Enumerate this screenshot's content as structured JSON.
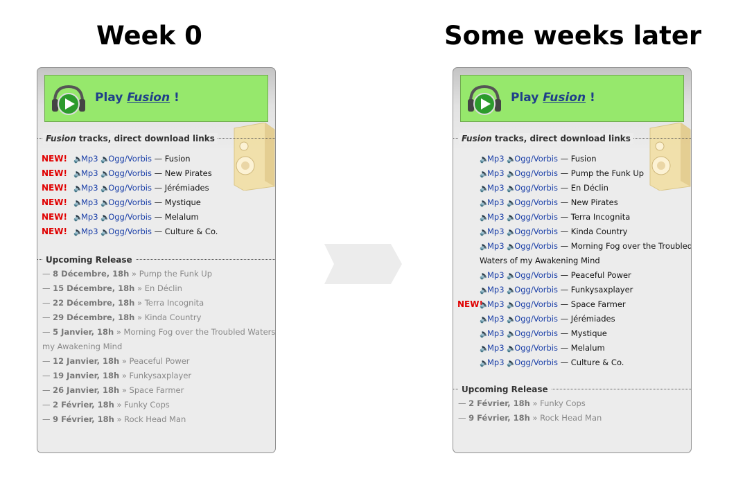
{
  "headings": {
    "left": "Week 0",
    "right": "Some weeks later"
  },
  "play": {
    "prefix": "Play",
    "album": "Fusion",
    "suffix": "!"
  },
  "section_tracks": {
    "album": "Fusion",
    "rest": " tracks, direct download links"
  },
  "section_upcoming": {
    "label": "Upcoming Release"
  },
  "link_labels": {
    "mp3": "Mp3",
    "ogg": "Ogg/Vorbis",
    "dash": "—",
    "new": "NEW!"
  },
  "week0": {
    "tracks": [
      {
        "title": "Fusion",
        "new": true
      },
      {
        "title": "New Pirates",
        "new": true
      },
      {
        "title": "Jérémiades",
        "new": true
      },
      {
        "title": "Mystique",
        "new": true
      },
      {
        "title": "Melalum",
        "new": true
      },
      {
        "title": "Culture & Co.",
        "new": true
      }
    ],
    "upcoming": [
      {
        "date": "8 Décembre, 18h",
        "title": "Pump the Funk Up"
      },
      {
        "date": "15 Décembre, 18h",
        "title": "En Déclin"
      },
      {
        "date": "22 Décembre, 18h",
        "title": "Terra Incognita"
      },
      {
        "date": "29 Décembre, 18h",
        "title": "Kinda Country"
      },
      {
        "date": "5 Janvier, 18h",
        "title": "Morning Fog over the Troubled Waters of",
        "title_cont": "my Awakening Mind"
      },
      {
        "date": "12 Janvier, 18h",
        "title": "Peaceful Power"
      },
      {
        "date": "19 Janvier, 18h",
        "title": "Funkysaxplayer"
      },
      {
        "date": "26 Janvier, 18h",
        "title": "Space Farmer"
      },
      {
        "date": "2 Février, 18h",
        "title": "Funky Cops"
      },
      {
        "date": "9 Février, 18h",
        "title": "Rock Head Man"
      }
    ]
  },
  "later": {
    "tracks": [
      {
        "title": "Fusion",
        "new": false
      },
      {
        "title": "Pump the Funk Up",
        "new": false
      },
      {
        "title": "En Déclin",
        "new": false
      },
      {
        "title": "New Pirates",
        "new": false
      },
      {
        "title": "Terra Incognita",
        "new": false
      },
      {
        "title": "Kinda Country",
        "new": false
      },
      {
        "title": "Morning Fog over the Troubled",
        "title_cont": "Waters of my Awakening Mind",
        "new": false
      },
      {
        "title": "Peaceful Power",
        "new": false
      },
      {
        "title": "Funkysaxplayer",
        "new": false
      },
      {
        "title": "Space Farmer",
        "new": true
      },
      {
        "title": "Jérémiades",
        "new": false
      },
      {
        "title": "Mystique",
        "new": false
      },
      {
        "title": "Melalum",
        "new": false
      },
      {
        "title": "Culture & Co.",
        "new": false
      }
    ],
    "upcoming": [
      {
        "date": "2 Février, 18h",
        "title": "Funky Cops"
      },
      {
        "date": "9 Février, 18h",
        "title": "Rock Head Man"
      }
    ]
  },
  "colors": {
    "new": "#e00000",
    "link": "#1a3fa8",
    "play_bg": "#96e86c",
    "play_text": "#1f3f8a"
  },
  "icons": {
    "headphones": "headphones-play-icon",
    "speaker": "speaker-box-icon",
    "audio": "audio-speaker-icon",
    "arrow": "chevron-arrow-icon"
  }
}
